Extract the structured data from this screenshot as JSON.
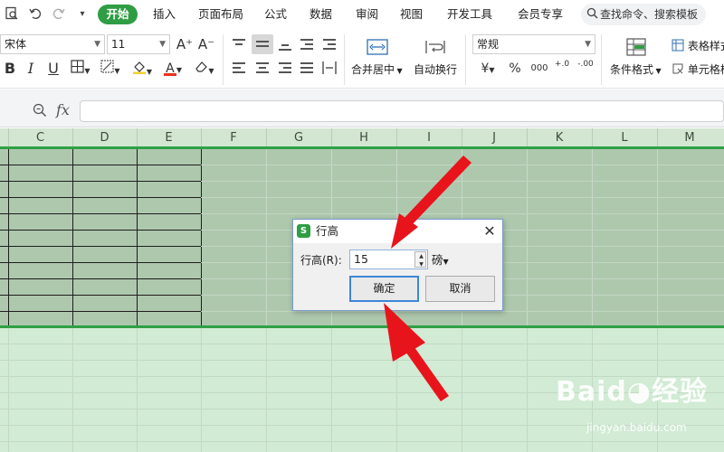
{
  "menubar": {
    "quick_icons": [
      "file-search-icon",
      "undo-icon",
      "redo-icon",
      "dropdown-icon"
    ],
    "tabs": [
      "开始",
      "插入",
      "页面布局",
      "公式",
      "数据",
      "审阅",
      "视图",
      "开发工具",
      "会员专享"
    ],
    "active_tab": "开始",
    "search_placeholder": "查找命令、搜索模板"
  },
  "ribbon": {
    "font_name": "宋体",
    "font_size": "11",
    "font_grow": "A⁺",
    "font_shrink": "A⁻",
    "bold": "B",
    "italic": "I",
    "underline": "U",
    "font_color_letter": "A",
    "merge_center_label": "合并居中",
    "wrap_text_label": "自动换行",
    "number_format": "常规",
    "currency_symbol": "¥",
    "percent_symbol": "%",
    "thousands_symbol": "000",
    "inc_decimal": "+.0",
    "dec_decimal": "-.00",
    "conditional_format_label": "条件格式",
    "table_style_label": "表格样式",
    "cell_style_label": "单元格样",
    "colors": {
      "accent": "#2f9d44",
      "font_color_bar": "#e8331c",
      "fill_color_bar": "#f5d130"
    }
  },
  "formula_bar": {
    "zoom_icon": "magnifier-icon",
    "fx_label": "fx",
    "value": ""
  },
  "sheet": {
    "columns": [
      "C",
      "D",
      "E",
      "F",
      "G",
      "H",
      "I",
      "J",
      "K",
      "L",
      "M"
    ],
    "colors": {
      "selected_fill": "#aec8ae",
      "grid_fill": "#d1ebd4",
      "selection_border": "#2fa044"
    }
  },
  "dialog": {
    "title": "行高",
    "field_label": "行高(R):",
    "value": "15",
    "unit": "磅",
    "ok_label": "确定",
    "cancel_label": "取消",
    "close_glyph": "✕"
  },
  "watermark": {
    "logo_text": "Baid◕经验",
    "url": "jingyan.baidu.com"
  }
}
